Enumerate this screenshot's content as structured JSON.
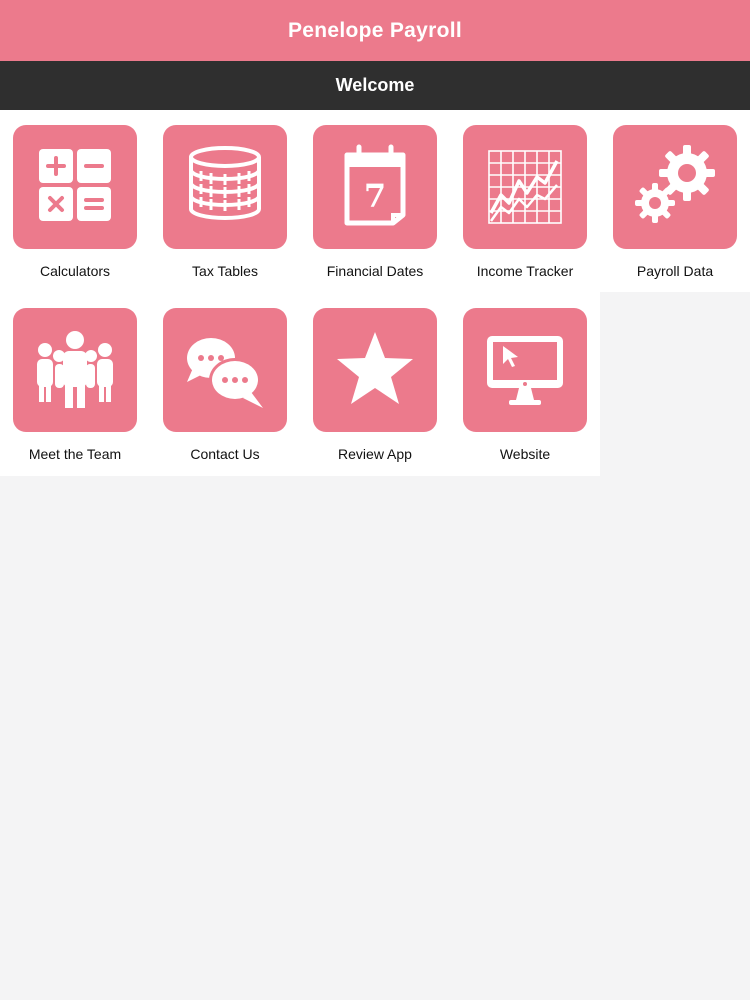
{
  "app": {
    "title": "Penelope Payroll"
  },
  "subheader": {
    "title": "Welcome"
  },
  "colors": {
    "accent": "#ec7a8c",
    "subheader_bg": "#2f2f2f",
    "page_bg": "#f4f4f5",
    "tile_area_bg": "#ffffff"
  },
  "tiles": [
    {
      "label": "Calculators",
      "icon": "calculator-icon"
    },
    {
      "label": "Tax Tables",
      "icon": "coin-stack-icon"
    },
    {
      "label": "Financial Dates",
      "icon": "calendar-icon",
      "icon_text": "7"
    },
    {
      "label": "Income Tracker",
      "icon": "line-chart-icon"
    },
    {
      "label": "Payroll Data",
      "icon": "gears-icon"
    },
    {
      "label": "Meet the Team",
      "icon": "team-icon"
    },
    {
      "label": "Contact Us",
      "icon": "chat-bubbles-icon"
    },
    {
      "label": "Review App",
      "icon": "star-icon"
    },
    {
      "label": "Website",
      "icon": "monitor-icon"
    }
  ]
}
